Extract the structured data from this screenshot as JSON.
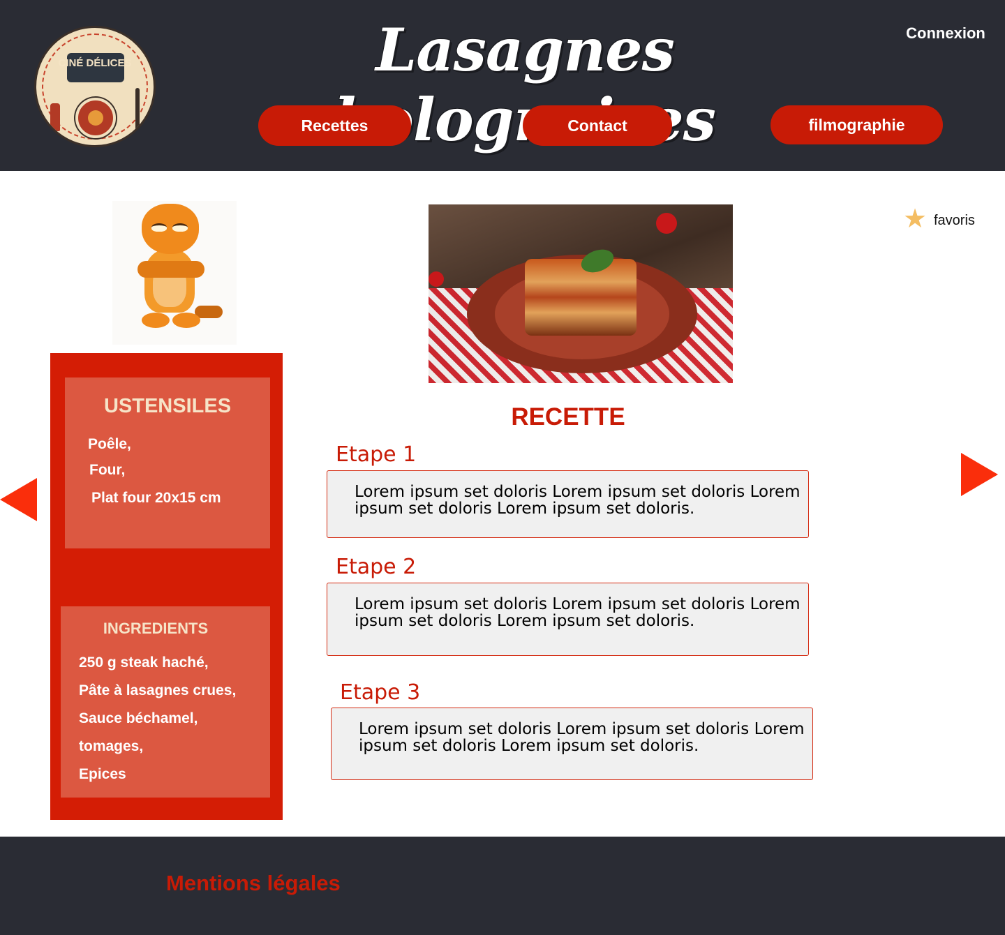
{
  "header": {
    "title": "Lasagnes bolognaises",
    "login_label": "Connexion",
    "logo_text": "CINÉ DÉLICES",
    "nav": {
      "recettes": "Recettes",
      "contact": "Contact",
      "filmographie": "filmographie"
    }
  },
  "favoris": {
    "label": "favoris",
    "icon": "star-icon"
  },
  "ustensiles": {
    "title": "USTENSILES",
    "items": [
      "Poêle,",
      "Four,",
      "Plat four 20x15 cm"
    ]
  },
  "ingredients": {
    "title": "INGREDIENTS",
    "items": [
      "250 g steak haché,",
      "Pâte à lasagnes crues,",
      "Sauce béchamel,",
      "tomages,",
      "Epices"
    ]
  },
  "recette": {
    "title": "RECETTE",
    "etapes": [
      {
        "title": "Etape 1",
        "text": "Lorem ipsum set doloris Lorem ipsum set doloris Lorem ipsum set doloris Lorem ipsum set doloris."
      },
      {
        "title": "Etape 2",
        "text": "Lorem ipsum set doloris Lorem ipsum set doloris Lorem ipsum set doloris Lorem ipsum set doloris."
      },
      {
        "title": "Etape 3",
        "text": "Lorem ipsum set doloris Lorem ipsum set doloris Lorem ipsum set doloris Lorem ipsum set doloris."
      }
    ]
  },
  "footer": {
    "mentions": "Mentions légales"
  },
  "colors": {
    "dark_bg": "#2a2c34",
    "accent_red": "#c81b06",
    "panel_red": "#d41d05",
    "box_red": "#dc5841",
    "arrow": "#fa2e0b",
    "star": "#f4bd62"
  }
}
